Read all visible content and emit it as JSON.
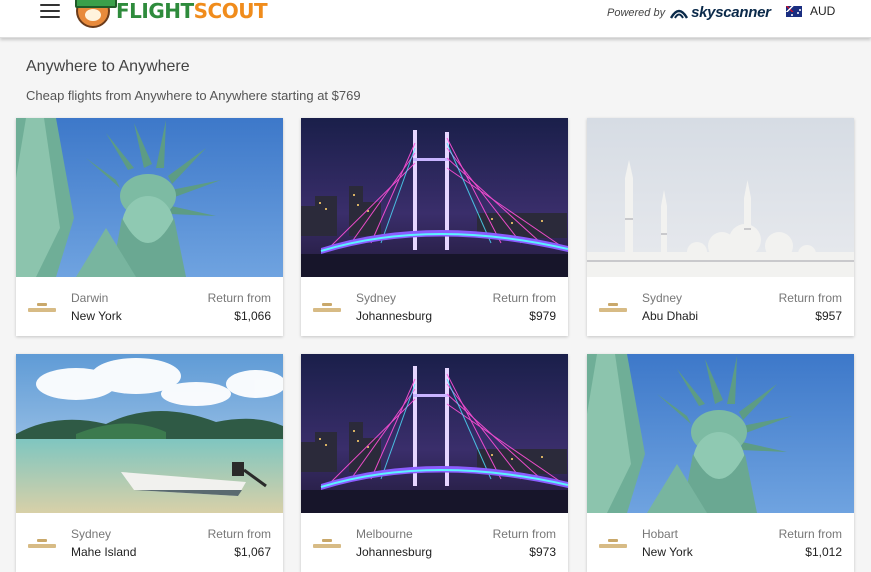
{
  "header": {
    "logo": {
      "part1": "FLIGHT",
      "part2": "SCOUT"
    },
    "powered_by": "Powered by",
    "skyscanner": "skyscanner",
    "currency": "AUD"
  },
  "page": {
    "title": "Anywhere to Anywhere",
    "subtitle": "Cheap flights from Anywhere to Anywhere starting at $769"
  },
  "cards": [
    {
      "origin": "Darwin",
      "destination": "New York",
      "return_label": "Return from",
      "price": "$1,066",
      "image": "statue-of-liberty",
      "airline": "etihad-logo"
    },
    {
      "origin": "Sydney",
      "destination": "Johannesburg",
      "return_label": "Return from",
      "price": "$979",
      "image": "bridge-night",
      "airline": "etihad-logo"
    },
    {
      "origin": "Sydney",
      "destination": "Abu Dhabi",
      "return_label": "Return from",
      "price": "$957",
      "image": "mosque",
      "airline": "etihad-logo"
    },
    {
      "origin": "Sydney",
      "destination": "Mahe Island",
      "return_label": "Return from",
      "price": "$1,067",
      "image": "island-boat",
      "airline": "etihad-logo"
    },
    {
      "origin": "Melbourne",
      "destination": "Johannesburg",
      "return_label": "Return from",
      "price": "$973",
      "image": "bridge-night",
      "airline": "etihad-logo"
    },
    {
      "origin": "Hobart",
      "destination": "New York",
      "return_label": "Return from",
      "price": "$1,012",
      "image": "statue-of-liberty",
      "airline": "etihad-logo"
    }
  ]
}
